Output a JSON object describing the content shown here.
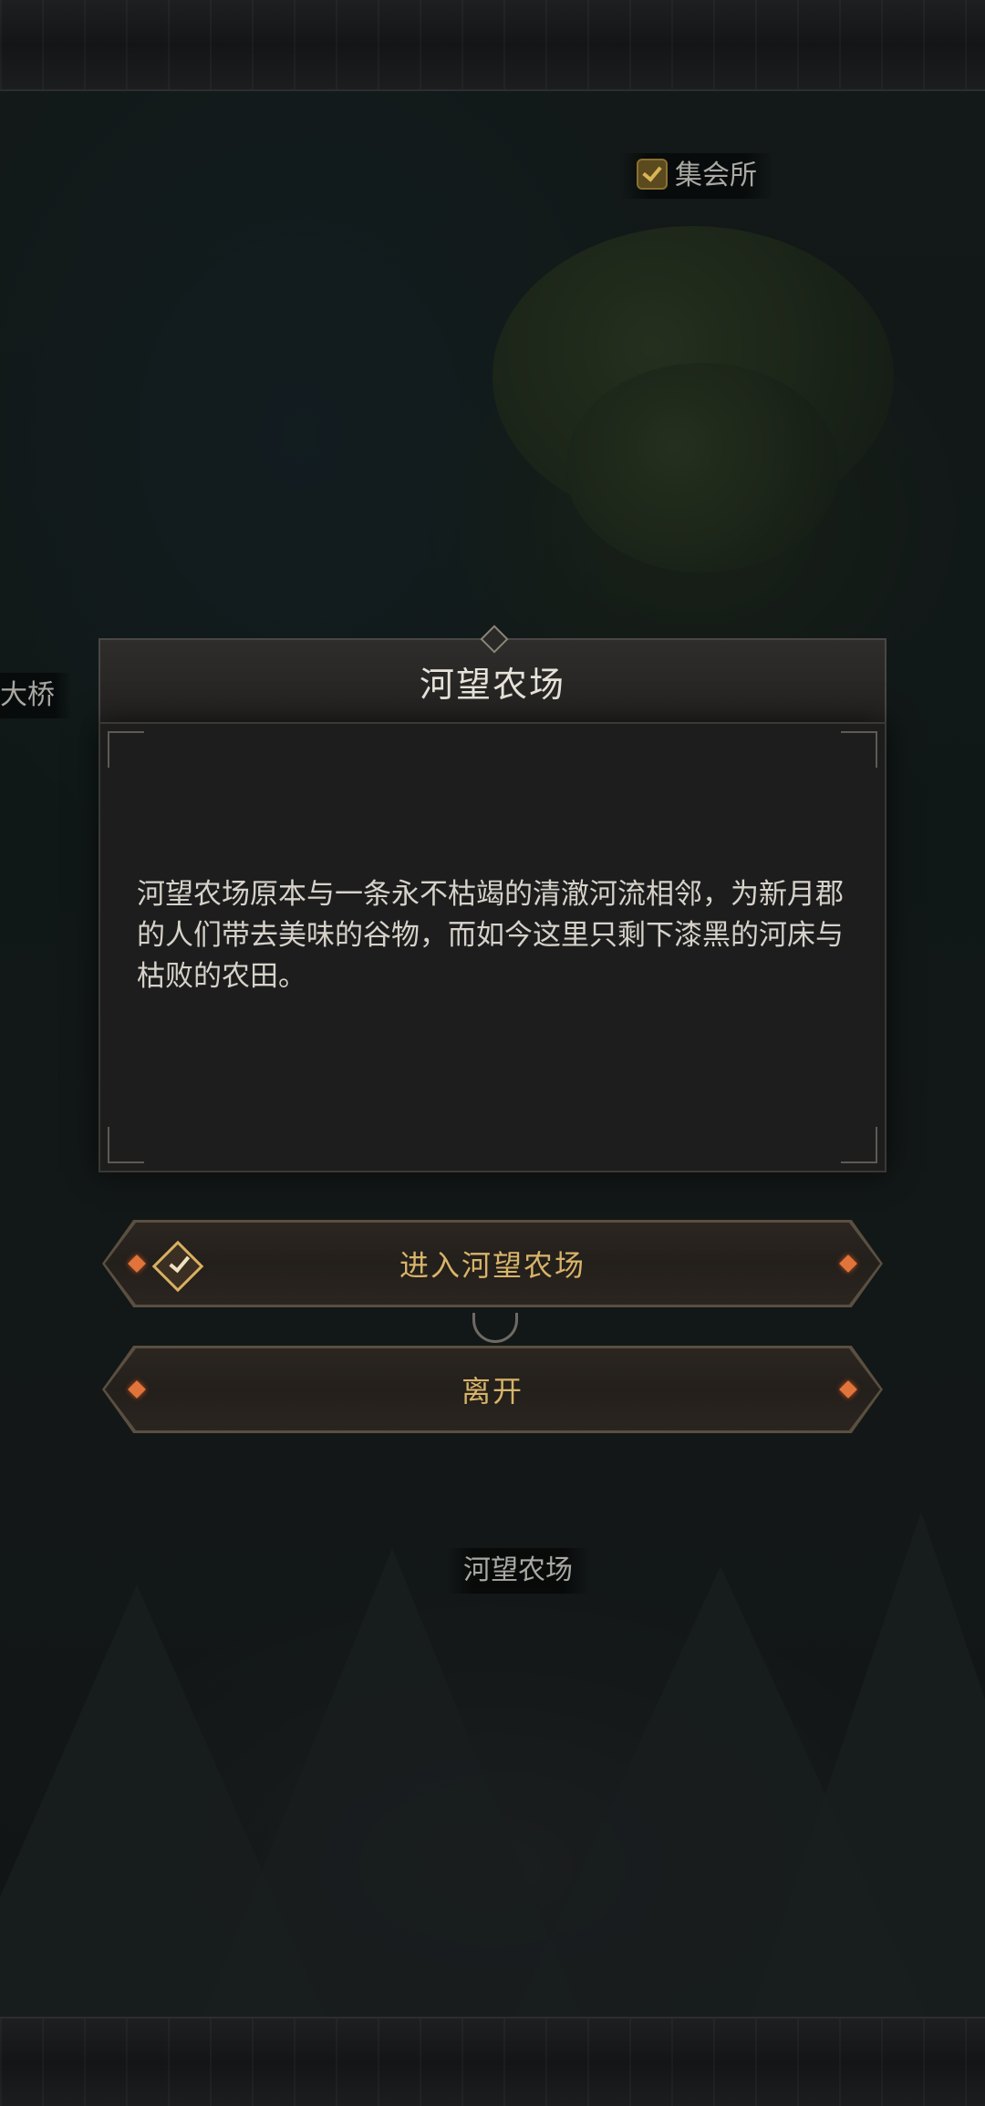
{
  "map": {
    "labels": {
      "gathering_hall": "集会所",
      "bridge": "大桥",
      "farm": "河望农场"
    }
  },
  "dialog": {
    "title": "河望农场",
    "description": "河望农场原本与一条永不枯竭的清澈河流相邻，为新月郡的人们带去美味的谷物，而如今这里只剩下漆黑的河床与枯败的农田。"
  },
  "actions": {
    "enter_label": "进入河望农场",
    "leave_label": "离开"
  },
  "colors": {
    "accent_gold": "#d8b46a",
    "gem_orange": "#e0743a",
    "panel_bg": "#1d1d1d"
  }
}
